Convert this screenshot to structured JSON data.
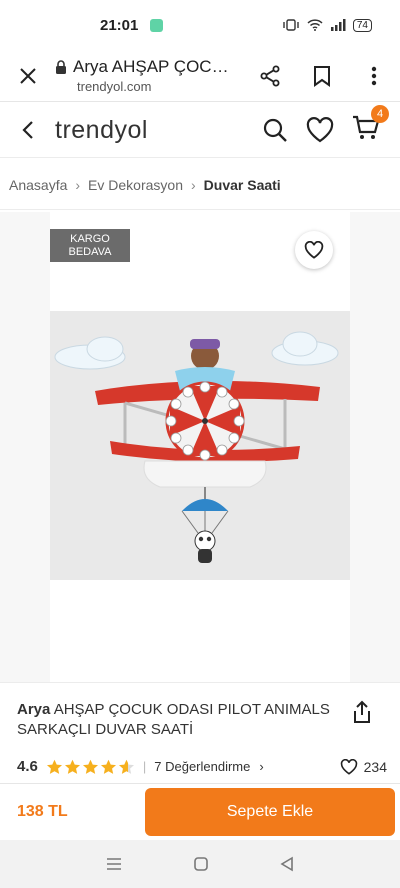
{
  "status": {
    "time": "21:01",
    "battery": "74"
  },
  "browser": {
    "title": "Arya AHŞAP ÇOC…",
    "domain": "trendyol.com"
  },
  "header": {
    "logo": "trendyol",
    "cart_count": "4"
  },
  "breadcrumb": {
    "items": [
      "Anasayfa",
      "Ev Dekorasyon",
      "Duvar Saati"
    ]
  },
  "gallery": {
    "badge_line1": "KARGO",
    "badge_line2": "BEDAVA"
  },
  "product": {
    "brand": "Arya",
    "name": "AHŞAP ÇOCUK ODASI PILOT ANIMALS SARKAÇLI DUVAR SAATİ",
    "rating": "4.6",
    "rating_value": 4.6,
    "reviews": "7 Değerlendirme",
    "favorites": "234"
  },
  "bottom": {
    "price": "138 TL",
    "add_to_cart": "Sepete Ekle"
  },
  "colors": {
    "accent": "#f27a1a",
    "badge_bg": "#6b6b6b",
    "star": "#f6b01e"
  },
  "icons": [
    "close-icon",
    "lock-icon",
    "share-icon",
    "bookmark-icon",
    "more-icon",
    "back-icon",
    "search-icon",
    "heart-icon",
    "cart-icon",
    "star-icon"
  ]
}
